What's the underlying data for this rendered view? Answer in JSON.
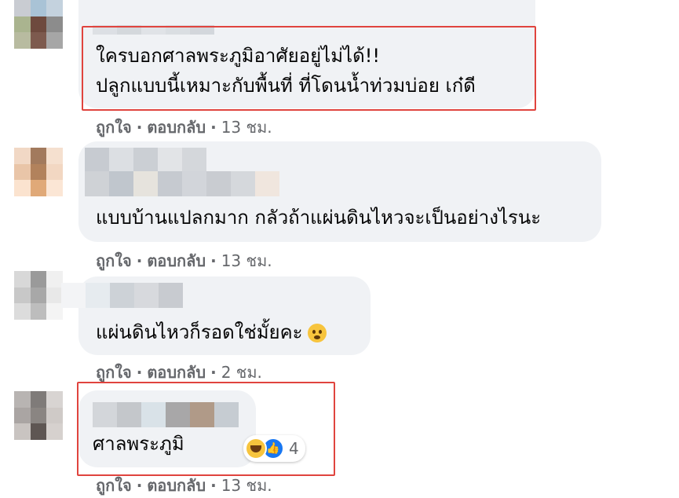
{
  "comments": [
    {
      "lines": [
        "ใครบอกศาลพระภูมิอาศัยอยู่ไม่ได้!!",
        "ปลูกแบบนี้เหมาะกับพื้นที่ ที่โดนน้ำท่วมบ่อย เก๋ดี"
      ],
      "like_label": "ถูกใจ",
      "reply_label": "ตอบกลับ",
      "time": "13 ชม."
    },
    {
      "lines": [
        "แบบบ้านแปลกมาก กลัวถ้าแผ่นดินไหวจะเป็นอย่างไรนะ"
      ],
      "like_label": "ถูกใจ",
      "reply_label": "ตอบกลับ",
      "time": "13 ชม."
    },
    {
      "lines": [
        "แผ่นดินไหวก็รอดใช่มั้ยคะ"
      ],
      "emoji": "sad-face-icon",
      "like_label": "ถูกใจ",
      "reply_label": "ตอบกลับ",
      "time": "2 ชม."
    },
    {
      "lines": [
        "ศาลพระภูมิ"
      ],
      "reactions": {
        "icons": [
          "haha-icon",
          "like-icon"
        ],
        "count": "4"
      },
      "like_label": "ถูกใจ",
      "reply_label": "ตอบกลับ",
      "time": "13 ชม."
    }
  ],
  "colors": {
    "bubble": "#f0f2f5",
    "highlight": "#e0443e",
    "meta": "#65676b"
  }
}
